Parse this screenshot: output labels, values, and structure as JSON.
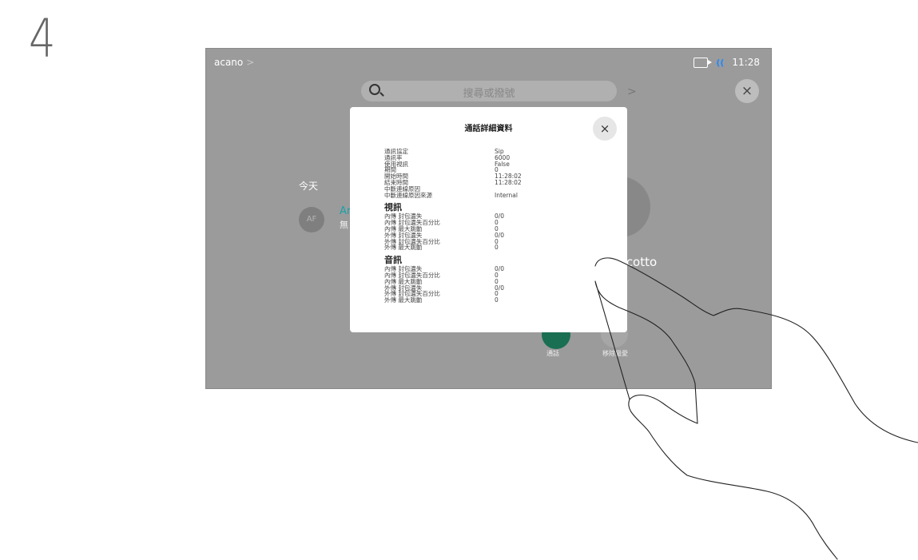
{
  "step_number": "4",
  "device": {
    "status": {
      "left_label": "acano",
      "left_chevron": ">",
      "time": "11:28",
      "mic_text": "((",
      "camera_icon": "camera-icon"
    },
    "search": {
      "placeholder": "搜尋或撥號",
      "chevron": ">"
    },
    "close_symbol": "×",
    "recents": {
      "today_label": "今天",
      "avatar_initials": "AF",
      "contact_name_partial": "Ar",
      "contact_sub_partial": "無"
    },
    "right_panel": {
      "name_partial": "scotto",
      "call_label": "通話",
      "remove_label": "移除最愛"
    }
  },
  "dialog": {
    "title": "通話詳細資料",
    "close_symbol": "×",
    "general": [
      {
        "label": "通訊協定",
        "value": "Sip"
      },
      {
        "label": "通訊率",
        "value": "6000"
      },
      {
        "label": "使用視訊",
        "value": "False"
      },
      {
        "label": "期間",
        "value": "0"
      },
      {
        "label": "開始時間",
        "value": "11:28:02"
      },
      {
        "label": "結束時間",
        "value": "11:28:02"
      },
      {
        "label": "中斷連線原因",
        "value": ""
      },
      {
        "label": "中斷連線原因來源",
        "value": "Internal"
      }
    ],
    "video": {
      "heading": "視訊",
      "rows": [
        {
          "label": "內傳 封包遺失",
          "value": "0/0"
        },
        {
          "label": "內傳 封包遺失百分比",
          "value": "0"
        },
        {
          "label": "內傳 最大跳動",
          "value": "0"
        },
        {
          "label": "外傳 封包遺失",
          "value": "0/0"
        },
        {
          "label": "外傳 封包遺失百分比",
          "value": "0"
        },
        {
          "label": "外傳 最大跳動",
          "value": "0"
        }
      ]
    },
    "audio": {
      "heading": "音訊",
      "rows": [
        {
          "label": "內傳 封包遺失",
          "value": "0/0"
        },
        {
          "label": "內傳 封包遺失百分比",
          "value": "0"
        },
        {
          "label": "內傳 最大跳動",
          "value": "0"
        },
        {
          "label": "外傳 封包遺失",
          "value": "0/0"
        },
        {
          "label": "外傳 封包遺失百分比",
          "value": "0"
        },
        {
          "label": "外傳 最大跳動",
          "value": "0"
        }
      ]
    }
  },
  "colors": {
    "screen_bg": "#9b9b9b",
    "mic_active": "#1e88ff",
    "call_green": "#1a6f52",
    "contact_teal": "#1ba0a8"
  }
}
